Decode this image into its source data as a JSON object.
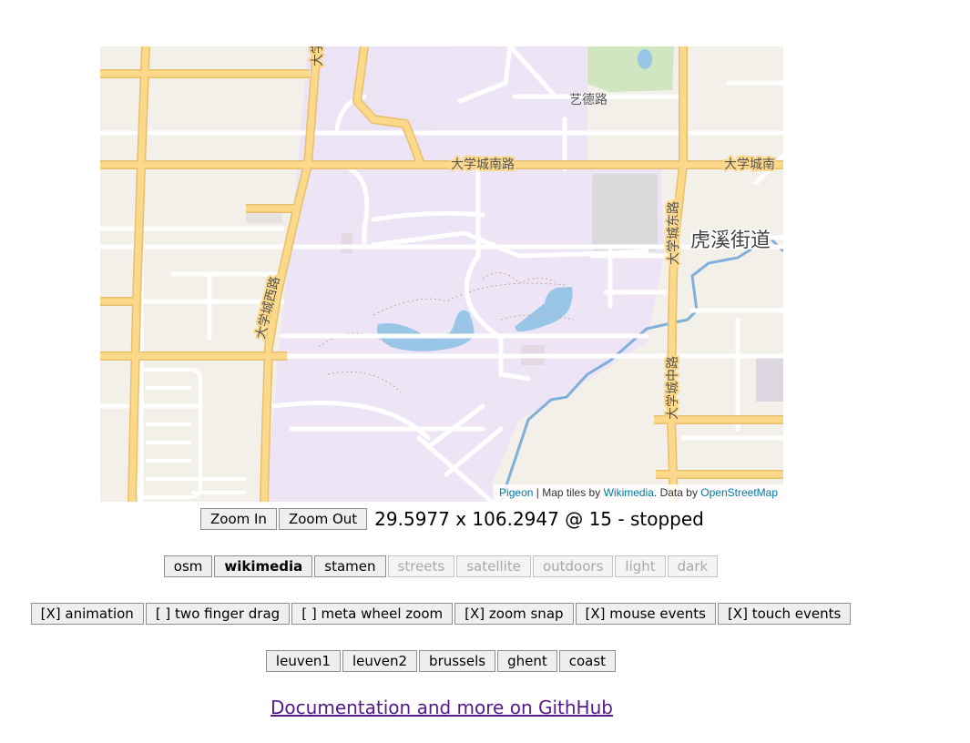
{
  "map": {
    "labels": {
      "yide_road": "艺德路",
      "daxuecheng_south_road": "大学城南路",
      "daxuecheng_south_road_cut": "大学城南",
      "daxuecheng_east_road": "大学城东路",
      "daxuecheng_west_road": "大学城西路",
      "daxuecheng_middle_road": "大学城中路",
      "huxi_subdistrict": "虎溪街道",
      "top_cut": "大学"
    },
    "colors": {
      "land": "#f3efe9",
      "campus": "#ede5f6",
      "major_road": "#fcd98a",
      "major_road_edge": "#e8bf6a",
      "minor_road": "#ffffff",
      "water": "#99c5e6",
      "river": "#7fb0da",
      "park": "#cfe6c0",
      "building": "#dcd7e0"
    },
    "attribution": {
      "pigeon": "Pigeon",
      "sep1": " | Map tiles by ",
      "wikimedia": "Wikimedia",
      "sep2": ". Data by ",
      "osm": "OpenStreetMap"
    }
  },
  "controls": {
    "zoom_in": "Zoom In",
    "zoom_out": "Zoom Out",
    "status": "29.5977 x 106.2947 @ 15 - stopped"
  },
  "providers": [
    {
      "label": "osm",
      "enabled": true,
      "active": false
    },
    {
      "label": "wikimedia",
      "enabled": true,
      "active": true
    },
    {
      "label": "stamen",
      "enabled": true,
      "active": false
    },
    {
      "label": "streets",
      "enabled": false,
      "active": false
    },
    {
      "label": "satellite",
      "enabled": false,
      "active": false
    },
    {
      "label": "outdoors",
      "enabled": false,
      "active": false
    },
    {
      "label": "light",
      "enabled": false,
      "active": false
    },
    {
      "label": "dark",
      "enabled": false,
      "active": false
    }
  ],
  "options": [
    {
      "label": "[X] animation"
    },
    {
      "label": "[ ] two finger drag"
    },
    {
      "label": "[ ] meta wheel zoom"
    },
    {
      "label": "[X] zoom snap"
    },
    {
      "label": "[X] mouse events"
    },
    {
      "label": "[X] touch events"
    }
  ],
  "locations": [
    {
      "label": "leuven1"
    },
    {
      "label": "leuven2"
    },
    {
      "label": "brussels"
    },
    {
      "label": "ghent"
    },
    {
      "label": "coast"
    }
  ],
  "footer": {
    "github_link": "Documentation and more on GithHub"
  }
}
